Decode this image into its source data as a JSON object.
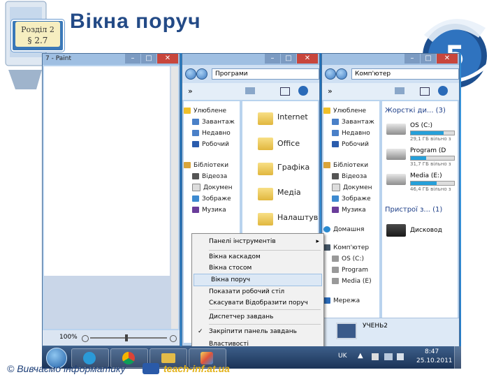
{
  "slide": {
    "section": "Розділ 2",
    "paragraph": "§ 2.7",
    "title": "Вікна поруч",
    "grade": "5",
    "footer_left": "© Вивчаємо інформатику",
    "footer_right": "teach-inf.at.ua"
  },
  "paint": {
    "title": "7 - Paint",
    "controls": [
      "–",
      "□",
      "✕"
    ],
    "zoom": "100%"
  },
  "explorer_left": {
    "controls": [
      "–",
      "□",
      "✕"
    ],
    "address": "Програми",
    "chevron": "»",
    "nav": {
      "favorites": "Улюблене",
      "fav_items": [
        "Завантаж",
        "Недавно",
        "Робочий"
      ],
      "libraries": "Бібліотеки",
      "lib_items": [
        "Відеоза",
        "Докумен",
        "Зображе",
        "Музика"
      ]
    },
    "folders": [
      "Internet",
      "Office",
      "Графіка",
      "Медіа",
      "Налаштув"
    ]
  },
  "explorer_right": {
    "controls": [
      "–",
      "□",
      "✕"
    ],
    "address": "Комп'ютер",
    "chevron": "»",
    "nav": {
      "favorites": "Улюблене",
      "fav_items": [
        "Завантаж",
        "Недавно",
        "Робочий"
      ],
      "libraries": "Бібліотеки",
      "lib_items": [
        "Відеоза",
        "Докумен",
        "Зображе",
        "Музика"
      ],
      "homegroup": "Домашня",
      "computer": "Комп'ютер",
      "comp_items": [
        "OS (C:)",
        "Program",
        "Media (E)"
      ],
      "network": "Мережа"
    },
    "hdd_group": "Жорсткі ди... (3)",
    "drives": [
      {
        "name": "OS (C:)",
        "info": "29,1 ГБ вільно з",
        "used": 0.75
      },
      {
        "name": "Program (D",
        "info": "31,7 ГБ вільно з",
        "used": 0.35
      },
      {
        "name": "Media (E:)",
        "info": "46,4 ГБ вільно з",
        "used": 0.6
      }
    ],
    "removable_group": "Пристрої з... (1)",
    "dvd": "Дисковод",
    "computer_name": "УЧЕНЬ2"
  },
  "context_menu": {
    "items": [
      {
        "label": "Панелі інструментів",
        "submenu": true,
        "checked": false
      },
      {
        "label": "Вікна каскадом",
        "submenu": false,
        "checked": false
      },
      {
        "label": "Вікна стосом",
        "submenu": false,
        "checked": false
      },
      {
        "label": "Вікна поруч",
        "submenu": false,
        "checked": false
      },
      {
        "label": "Показати робочий стіл",
        "submenu": false,
        "checked": false
      },
      {
        "label": "Скасувати Відобразити поруч",
        "submenu": false,
        "checked": false
      },
      {
        "label": "Диспетчер завдань",
        "submenu": false,
        "checked": false
      },
      {
        "label": "Закріпити панель завдань",
        "submenu": false,
        "checked": true
      },
      {
        "label": "Властивості",
        "submenu": false,
        "checked": false
      }
    ]
  },
  "taskbar": {
    "lang": "UK",
    "time": "8:47",
    "date": "25.10.2011"
  }
}
